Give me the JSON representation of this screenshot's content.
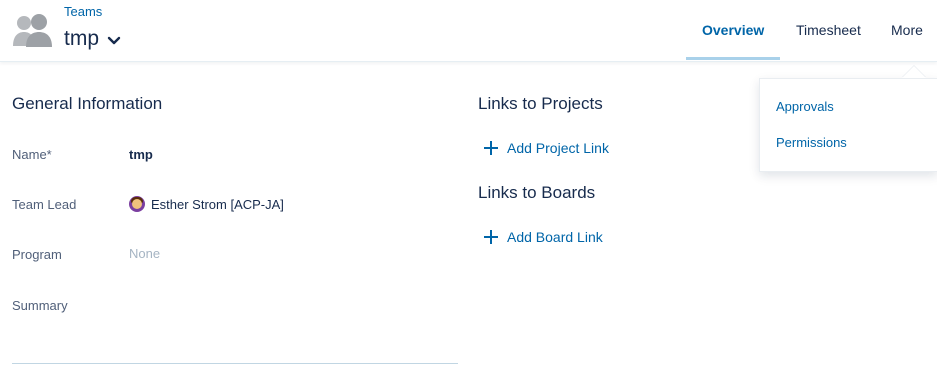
{
  "header": {
    "breadcrumb": "Teams",
    "title": "tmp",
    "tabs": [
      {
        "label": "Overview",
        "active": true
      },
      {
        "label": "Timesheet",
        "active": false
      },
      {
        "label": "More",
        "active": false
      }
    ]
  },
  "general_info": {
    "title": "General Information",
    "fields": [
      {
        "label": "Name*",
        "value": "tmp"
      },
      {
        "label": "Team Lead",
        "value": "Esther Strom [ACP-JA]"
      },
      {
        "label": "Program",
        "value": "None"
      },
      {
        "label": "Summary",
        "value": ""
      }
    ]
  },
  "links_projects": {
    "title": "Links to Projects",
    "add_label": "Add Project Link"
  },
  "links_boards": {
    "title": "Links to Boards",
    "add_label": "Add Board Link"
  },
  "more_menu": {
    "items": [
      "Approvals",
      "Permissions"
    ]
  },
  "colors": {
    "accent": "#0065a8",
    "text": "#172b4d",
    "muted": "#a5b4c3",
    "tab_underline": "#a9d1ea"
  }
}
